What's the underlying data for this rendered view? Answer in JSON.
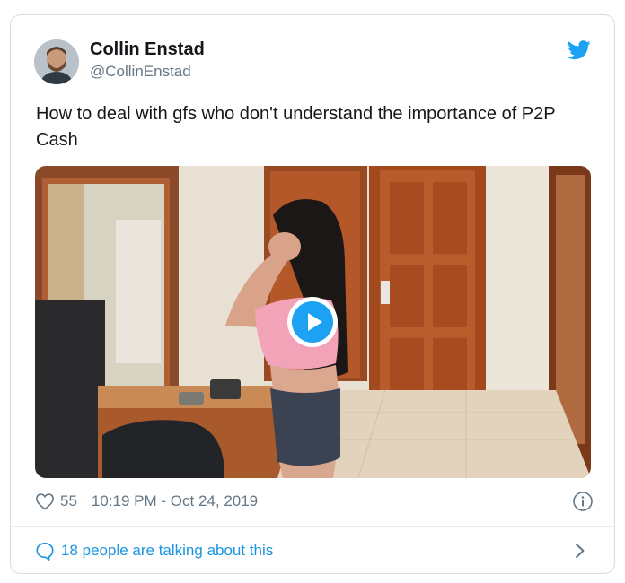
{
  "tweet": {
    "author": {
      "name": "Collin Enstad",
      "handle": "@CollinEnstad"
    },
    "text": "How to deal with gfs who don't understand the importance of P2P Cash",
    "likes": "55",
    "timestamp": "10:19 PM - Oct 24, 2019",
    "conversation": "18 people are talking about this"
  },
  "icons": {
    "brand": "twitter-bird-icon",
    "like": "heart-icon",
    "info": "info-icon",
    "reply": "speech-bubble-icon",
    "more": "chevron-right-icon",
    "media": "play-icon"
  },
  "colors": {
    "brand": "#1da1f2",
    "link": "#1b95e0",
    "secondary_text": "#657786",
    "primary_text": "#14171a",
    "border": "#d9dde1"
  }
}
